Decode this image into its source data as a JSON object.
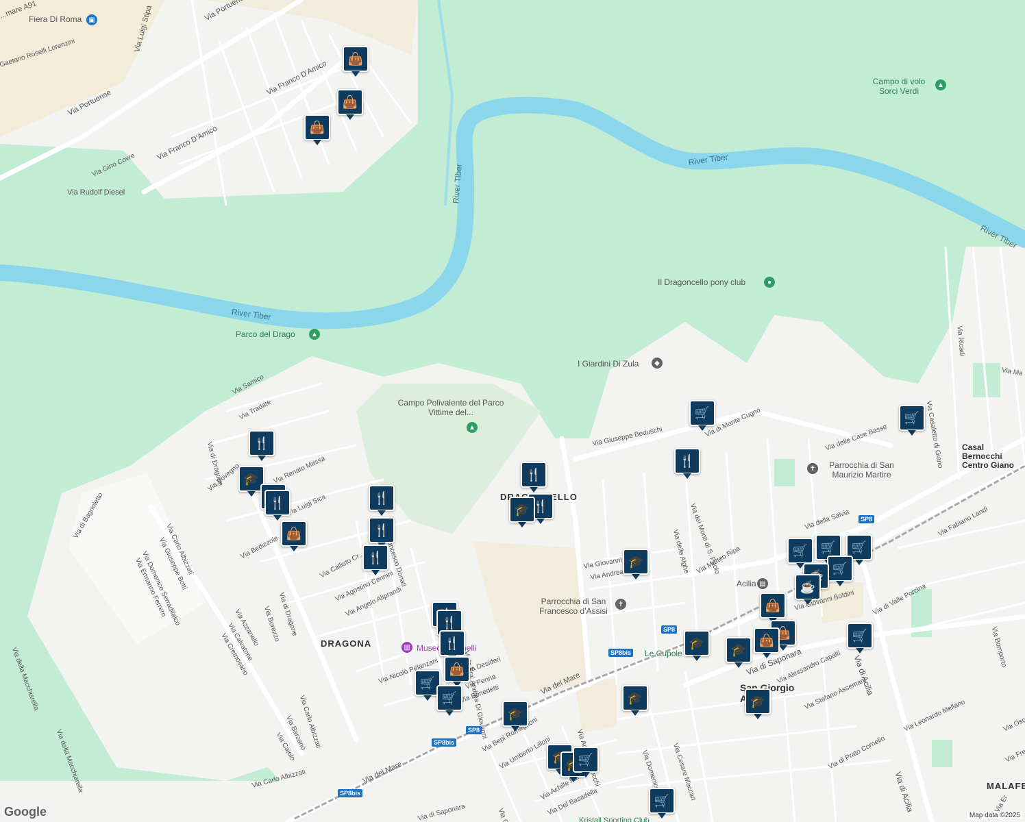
{
  "map": {
    "colors": {
      "park": "#c2ecd4",
      "water": "#8ad6ea",
      "urban": "#f3f3f1",
      "road": "#ffffff",
      "pin": "#0e3b5e",
      "badge": "#1a73c8"
    },
    "places": {
      "fiera_di_roma": "Fiera Di Roma",
      "campo_polivalente": "Campo Polivalente del Parco Vittime del...",
      "parco_del_drago": "Parco del Drago",
      "pony_club": "Il Dragoncello pony club",
      "giardini_zula": "I Giardini Di Zula",
      "campo_volo": "Campo di volo Sorci Verdi",
      "parrocchia_maurizio": "Parrocchia di San Maurizio Martire",
      "parrocchia_francesco": "Parrocchia di San Francesco d'Assisi",
      "le_cupole": "Le Cupole",
      "museo": "Museo Pastinelli",
      "acilia_station": "Acilia",
      "casal_bernocchi": "Casal Bernocchi Centro Giano",
      "kristall": "Kristall Sporting Club"
    },
    "areas": {
      "dragona": "DRAGONA",
      "dragoncello": "DRAGONCELLO",
      "san_giorgio": "San Giorgio Acilia",
      "malafede": "MALAFE"
    },
    "rivers": {
      "r1": "River Tiber",
      "r2": "River Tiber",
      "r3": "River Tiber",
      "r4": "River Tiber"
    },
    "streets": {
      "s1": "Via Portuense",
      "s2": "Via Portuense",
      "s3": "Via Luigi Stipa",
      "s4": "Via Franco D'Amico",
      "s5": "Via Franco D'Amico",
      "s6": "Via Rudolf Diesel",
      "s7": "Via Gino Covre",
      "s8": "Gaetano Roselli Lorenzini",
      "s9": "Via Samico",
      "s10": "Via Tradate",
      "s11": "Via di Dragone",
      "s12": "Via Bovegno",
      "s13": "Via Carlo Albizzati",
      "s14": "Via Giuseppe Botti",
      "s15": "Via Domenico Serradifalco",
      "s16": "Via Ermanno Ferrero",
      "s17": "Via di Bagnoletto",
      "s18": "Via della Macchiarella",
      "s19": "Via della Macchiarella",
      "s20": "Via Bedizzole",
      "s21": "Via di Dragone",
      "s22": "Via Borezzo",
      "s23": "Via Callisto Cr...",
      "s24": "Via Agostino Cennini",
      "s25": "Via Angelo Aliprandi",
      "s26": "Via Azzanello",
      "s27": "Via Calvatone",
      "s28": "Via Cremosano",
      "s29": "Via Carlo Albizzati",
      "s30": "Via Barzanò",
      "s31": "Via Caiolo",
      "s32": "Via Carlo Albizzati",
      "s33": "Via del Mare",
      "s34": "Via del Mare",
      "s35": "Viale Fra' Andrea Di Giovanni",
      "s36": "Via Giuseppe Beduschi",
      "s37": "Via di Monte Cugno",
      "s38": "Via dei Monti di S. Paolo",
      "s39": "Via delle Alghe",
      "s40": "Via Matteo Ripa",
      "s41": "Via delle Case Basse",
      "s42": "Via della Salvia",
      "s43": "Via Fabiano Landi",
      "s44": "Via di Valle Porcina",
      "s45": "Via di Saponara",
      "s46": "Via Alessandro Capalti",
      "s47": "Via di Acilia",
      "s48": "Via di Acilia",
      "s49": "Via Leonardo Mellano",
      "s50": "Via di Prato Cornelio",
      "s51": "Via Cesare Maccari",
      "s52": "Via Domenico Morelli",
      "s53": "Via Amedeo Bocchi",
      "s54": "Via Bepi Romagnoni",
      "s55": "Via Umberto Lilloni",
      "s56": "Via Achille Funi",
      "s57": "Via Del Basadella",
      "s58": "Via Ricadi",
      "s59": "Via Casaletto di Giano",
      "s60": "Via Bomporto",
      "s61": "Via Stefano Assemani",
      "s62": "Via Giovanni Boldini",
      "s63": "Via Giovanni...",
      "s64": "Via Andrea...",
      "s65": "Via Nicolò Pelanzani",
      "s66": "Via di Saponara",
      "s67": "Via Francesco Donati",
      "s68": "Via Luigi Sica",
      "s69": "Via Oscar",
      "s70": "Via Ma",
      "s71": "Via Fre",
      "s72": "Via Er",
      "s73": "Via Corrado",
      "s74": "Via Desideri",
      "s75": "Via Penna",
      "s76": "Via Benedetti",
      "s77": "...mare A91",
      "s78": "Via Renato Massa"
    },
    "badges": {
      "b1": "SP8",
      "b2": "SP8",
      "b3": "SP8bis",
      "b4": "SP8",
      "b5": "SP8bis",
      "b6": "SP8bis"
    },
    "pins": {
      "shopping": "shopping-bag-icon",
      "restaurant": "restaurant-icon",
      "school": "school-icon",
      "grocery": "shopping-cart-icon",
      "cafe": "cafe-icon"
    },
    "attribution": "Map data ©2025",
    "logo": "Google"
  }
}
